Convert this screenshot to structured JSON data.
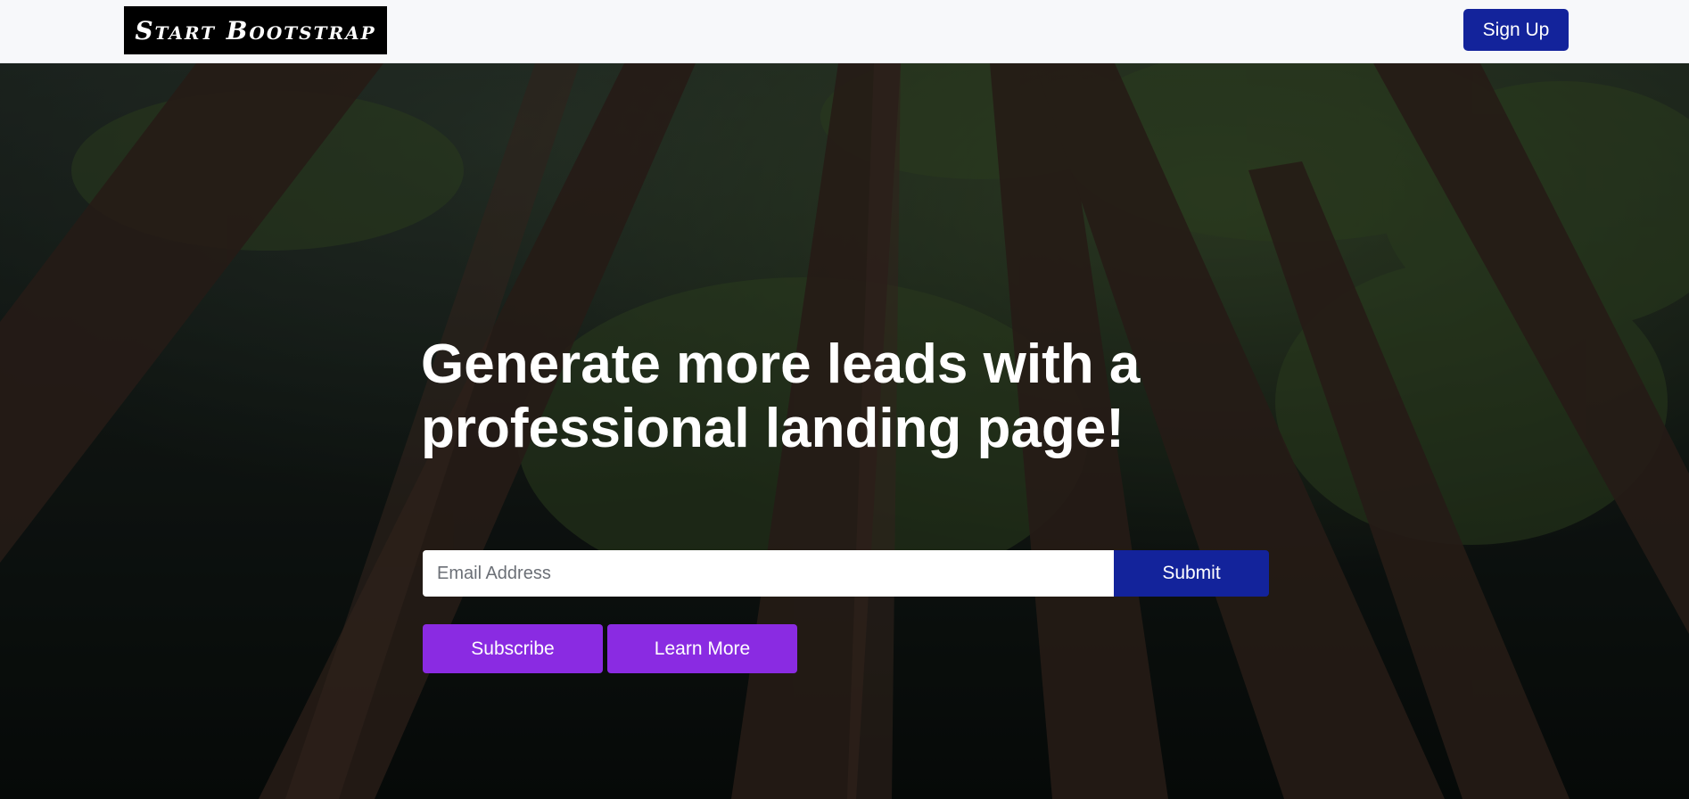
{
  "navbar": {
    "brand": "Start Bootstrap",
    "signup_label": "Sign Up"
  },
  "hero": {
    "headline": "Generate more leads with a professional landing page!",
    "email_placeholder": "Email Address",
    "submit_label": "Submit",
    "subscribe_label": "Subscribe",
    "learn_more_label": "Learn More"
  },
  "colors": {
    "primary": "#13239b",
    "accent_purple": "#8a2be2",
    "navbar_bg": "#f7f8fa"
  }
}
